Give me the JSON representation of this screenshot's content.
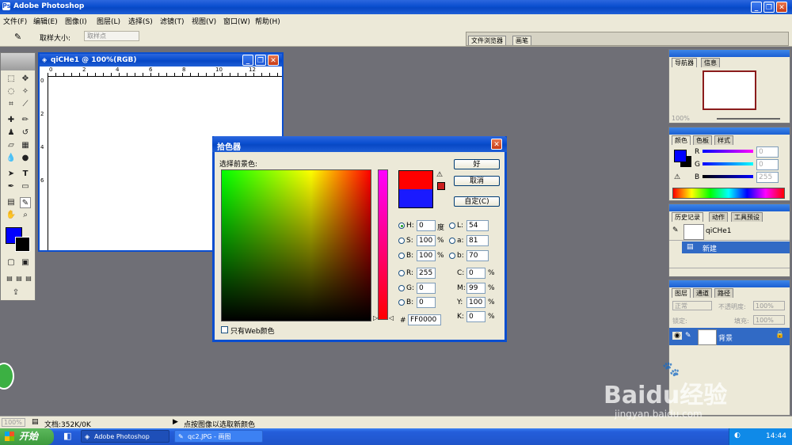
{
  "app": {
    "title": "Adobe Photoshop"
  },
  "menu": [
    "文件(F)",
    "编辑(E)",
    "图像(I)",
    "图层(L)",
    "选择(S)",
    "滤镜(T)",
    "视图(V)",
    "窗口(W)",
    "帮助(H)"
  ],
  "options": {
    "sample_size_label": "取样大小:",
    "sample_value": "取样点",
    "file_browser_tab": "文件浏览器",
    "brush_tab": "画笔"
  },
  "document": {
    "title": "qiCHe1 @ 100%(RGB)",
    "ruler_ticks": [
      "0",
      "2",
      "4",
      "6",
      "8",
      "10",
      "12"
    ],
    "ruler_v_ticks": [
      "0",
      "2",
      "4",
      "6"
    ]
  },
  "navigator": {
    "tabs": [
      "导航器",
      "信息"
    ],
    "zoom": "100%"
  },
  "color_panel": {
    "tabs": [
      "颜色",
      "色板",
      "样式"
    ],
    "channels": [
      {
        "label": "R",
        "value": "0"
      },
      {
        "label": "G",
        "value": "0"
      },
      {
        "label": "B",
        "value": "255"
      }
    ]
  },
  "history": {
    "tabs": [
      "历史记录",
      "动作",
      "工具预设"
    ],
    "snapshot": "qiCHe1",
    "items": [
      "新建"
    ]
  },
  "layers": {
    "tabs": [
      "图层",
      "通道",
      "路径"
    ],
    "blend": "正常",
    "opacity_label": "不透明度:",
    "opacity": "100%",
    "lock_label": "锁定:",
    "fill_label": "填充:",
    "fill": "100%",
    "layer_name": "背景"
  },
  "color_picker": {
    "title": "拾色器",
    "prompt": "选择前景色:",
    "ok": "好",
    "cancel": "取消",
    "custom": "自定(C)",
    "hsb": [
      {
        "label": "H:",
        "value": "0",
        "unit": "度"
      },
      {
        "label": "S:",
        "value": "100",
        "unit": "%"
      },
      {
        "label": "B:",
        "value": "100",
        "unit": "%"
      }
    ],
    "rgb": [
      {
        "label": "R:",
        "value": "255"
      },
      {
        "label": "G:",
        "value": "0"
      },
      {
        "label": "B:",
        "value": "0"
      }
    ],
    "lab": [
      {
        "label": "L:",
        "value": "54"
      },
      {
        "label": "a:",
        "value": "81"
      },
      {
        "label": "b:",
        "value": "70"
      }
    ],
    "cmyk": [
      {
        "label": "C:",
        "value": "0",
        "unit": "%"
      },
      {
        "label": "M:",
        "value": "99",
        "unit": "%"
      },
      {
        "label": "Y:",
        "value": "100",
        "unit": "%"
      },
      {
        "label": "K:",
        "value": "0",
        "unit": "%"
      }
    ],
    "hex_label": "#",
    "hex": "FF0000",
    "web_only": "只有Web颜色",
    "new_color": "#ff0000",
    "old_color": "#1a1aff"
  },
  "status": {
    "zoom": "100%",
    "doc": "文档:352K/0K",
    "hint": "点按图像以选取新颜色"
  },
  "taskbar": {
    "start": "开始",
    "items": [
      "Adobe Photoshop",
      "qc2.JPG - 画图"
    ],
    "time": "14:44"
  },
  "watermark": {
    "text": "Baidu经验",
    "url": "jingyan.baidu.com"
  },
  "colors": {
    "accent": "#0a4ecf",
    "foreground": "#0000ff",
    "taskbar": "#245edb",
    "start": "#3c9a3c"
  },
  "icons": [
    "photoshop-icon",
    "eyedropper-icon",
    "minimize-icon",
    "maximize-icon",
    "close-icon",
    "warning-icon",
    "eye-icon",
    "lock-icon",
    "clock-icon"
  ]
}
